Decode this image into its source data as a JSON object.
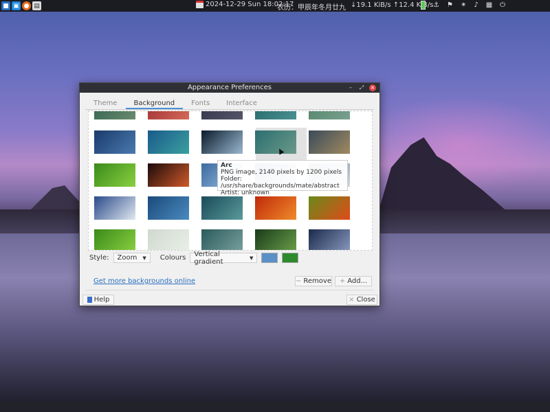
{
  "panel": {
    "datetime": "2024-12-29 Sun 18:02:17",
    "lunar_date": "农历：甲辰年冬月廿九",
    "net_down": "↓19.1 KiB/s",
    "net_up": "↑12.4 KiB/s",
    "tray_icons": [
      "battery-icon",
      "usb-icon",
      "flag-icon",
      "bluetooth-icon",
      "volume-icon",
      "network-icon",
      "power-icon"
    ]
  },
  "window": {
    "title": "Appearance Preferences",
    "tabs": [
      {
        "label": "Theme"
      },
      {
        "label": "Background"
      },
      {
        "label": "Fonts"
      },
      {
        "label": "Interface"
      }
    ],
    "tooltip": {
      "name": "Arc",
      "line1": "PNG image, 2140 pixels by 1200 pixels",
      "line2": "Folder: /usr/share/backgrounds/mate/abstract",
      "line3": "Artist: unknown"
    },
    "style_label": "Style:",
    "style_value": "Zoom",
    "colours_label": "Colours",
    "colours_value": "Vertical gradient",
    "primary_color": "#5b8fc8",
    "secondary_color": "#2e8a2e",
    "more_link": "Get more backgrounds online",
    "remove_label": "Remove",
    "add_label": "Add...",
    "help_label": "Help",
    "close_label": "Close"
  },
  "thumbnails": [
    {
      "name": "top-row-1",
      "c1": "#3b6b53",
      "c2": "#6a8a70"
    },
    {
      "name": "top-row-2",
      "c1": "#a83a3a",
      "c2": "#d46a5a"
    },
    {
      "name": "top-row-3",
      "c1": "#3a3a50",
      "c2": "#55556a"
    },
    {
      "name": "top-row-4",
      "c1": "#2c7070",
      "c2": "#4a9090"
    },
    {
      "name": "top-row-5",
      "c1": "#5a8a70",
      "c2": "#7aa090"
    },
    {
      "name": "blue-dots",
      "c1": "#1a3a6a",
      "c2": "#4a7ab0"
    },
    {
      "name": "lake-mountains",
      "c1": "#1a5a8a",
      "c2": "#3aa0a0"
    },
    {
      "name": "water-drop",
      "c1": "#0a1a2a",
      "c2": "#9ab8d0"
    },
    {
      "name": "arc-teal",
      "c1": "#2c6e70",
      "c2": "#6a9a88"
    },
    {
      "name": "alpine-sunset",
      "c1": "#3a4a5a",
      "c2": "#a08a60"
    },
    {
      "name": "green-leaf",
      "c1": "#3a8a1a",
      "c2": "#8ad040"
    },
    {
      "name": "helix-nebula",
      "c1": "#1a0a0a",
      "c2": "#d05a2a"
    },
    {
      "name": "hidden-1",
      "c1": "#3a6aa0",
      "c2": "#a0c0e0"
    },
    {
      "name": "hidden-2",
      "c1": "#3a4a8a",
      "c2": "#c0d0e0"
    },
    {
      "name": "hidden-3",
      "c1": "#5a6a8a",
      "c2": "#d0d8e0"
    },
    {
      "name": "snow-peaks",
      "c1": "#2a4a8a",
      "c2": "#e0e8f0"
    },
    {
      "name": "blue-bubbles",
      "c1": "#1a4a7a",
      "c2": "#4a8ac0"
    },
    {
      "name": "teal-gradient",
      "c1": "#1a4a5a",
      "c2": "#5a9a9a"
    },
    {
      "name": "orange-flower",
      "c1": "#c02a0a",
      "c2": "#f08a2a"
    },
    {
      "name": "red-flower",
      "c1": "#6a8a1a",
      "c2": "#e04a1a"
    },
    {
      "name": "grass",
      "c1": "#3a8a1a",
      "c2": "#8ad040"
    },
    {
      "name": "green-arrow",
      "c1": "#d0d8d0",
      "c2": "#e8f0e8"
    },
    {
      "name": "teal-wave",
      "c1": "#2a5a5a",
      "c2": "#7aa0a0"
    },
    {
      "name": "green-plant",
      "c1": "#1a3a1a",
      "c2": "#6aa04a"
    },
    {
      "name": "lake-dusk",
      "c1": "#1a2a4a",
      "c2": "#8a9ac0"
    }
  ]
}
